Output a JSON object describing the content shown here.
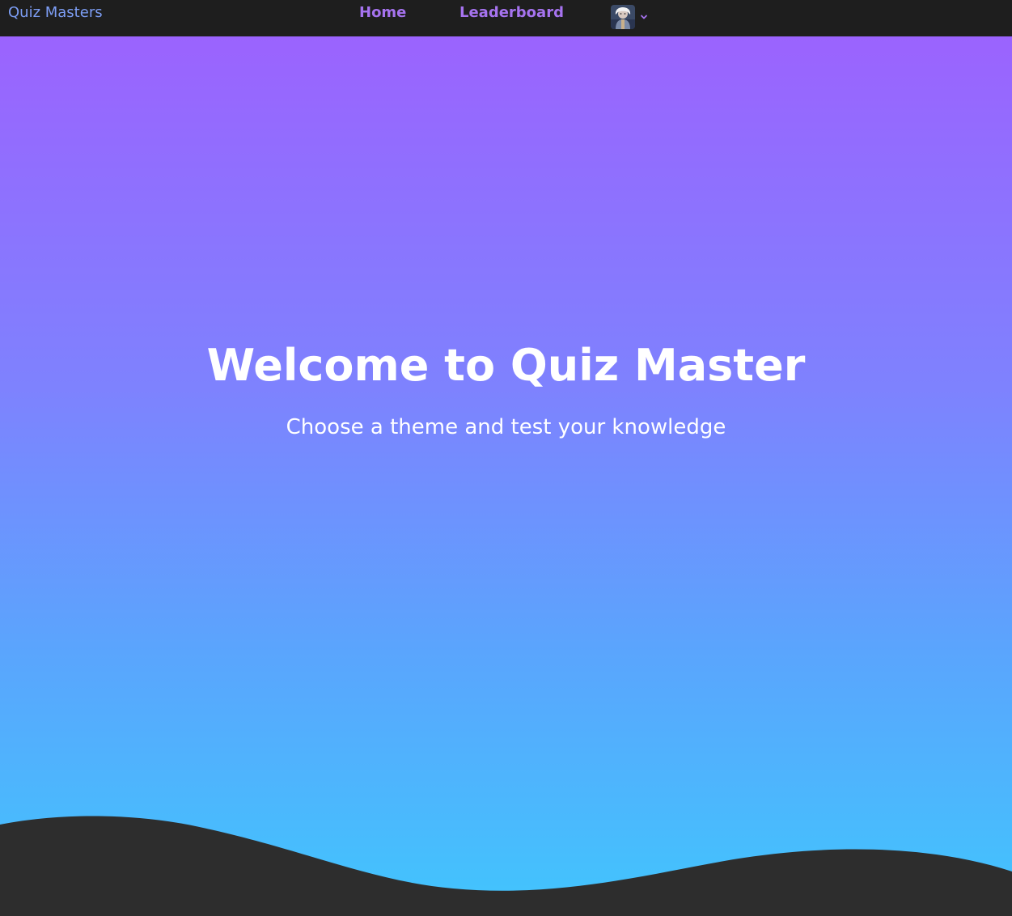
{
  "navbar": {
    "brand": "Quiz Masters",
    "links": [
      {
        "label": "Home"
      },
      {
        "label": "Leaderboard"
      }
    ],
    "user_menu": {
      "avatar_icon": "user-avatar",
      "chevron_icon": "chevron-down-icon"
    }
  },
  "hero": {
    "title": "Welcome to Quiz Master",
    "subtitle": "Choose a theme and test your knowledge"
  },
  "colors": {
    "navbar_bg": "#1e1e1e",
    "brand": "#7d9ef5",
    "nav_link": "#a673ef",
    "gradient_top": "#9b63fe",
    "gradient_bottom": "#41c5fd",
    "wave": "#2d2d2d",
    "hero_text": "#ffffff"
  }
}
